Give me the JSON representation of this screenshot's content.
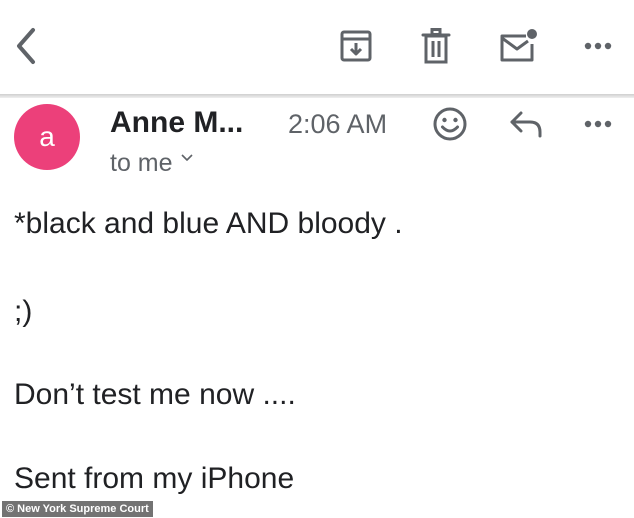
{
  "toolbar": {
    "icons": [
      "back-arrow-icon",
      "archive-icon",
      "trash-icon",
      "mark-unread-icon",
      "more-icon"
    ]
  },
  "message": {
    "sender_initial": "a",
    "sender_name": "Anne M...",
    "time": "2:06 AM",
    "recipient_label": "to me",
    "avatar_color": "#ec407a",
    "header_icons": [
      "emoji-icon",
      "reply-icon",
      "more-icon"
    ]
  },
  "body": {
    "lines": [
      "*black and blue AND bloody .",
      ";)",
      "Don’t test me now ....",
      "Sent from my iPhone"
    ]
  },
  "credit": "© New York Supreme Court"
}
